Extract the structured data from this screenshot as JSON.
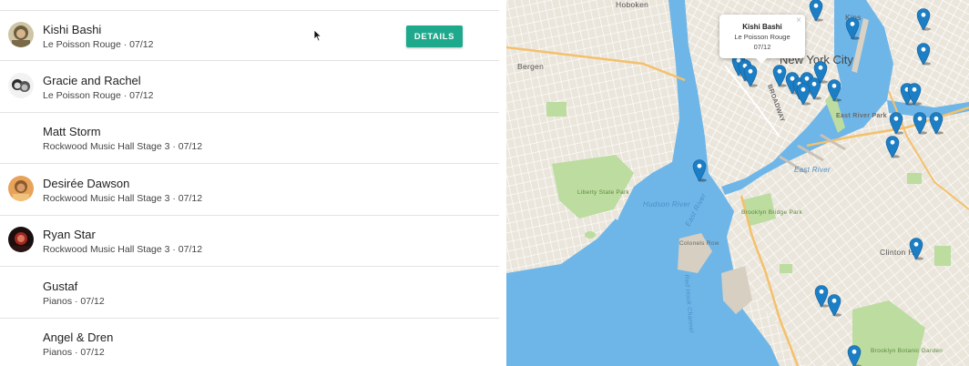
{
  "events": [
    {
      "title": "Kishi Bashi",
      "venue": "Le Poisson Rouge · 07/12",
      "has_avatar": true,
      "avatar": "avatar-kishi",
      "show_details": true
    },
    {
      "title": "Gracie and Rachel",
      "venue": "Le Poisson Rouge · 07/12",
      "has_avatar": true,
      "avatar": "avatar-gracie",
      "show_details": false
    },
    {
      "title": "Matt Storm",
      "venue": "Rockwood Music Hall Stage 3 · 07/12",
      "has_avatar": false,
      "show_details": false
    },
    {
      "title": "Desirée Dawson",
      "venue": "Rockwood Music Hall Stage 3 · 07/12",
      "has_avatar": true,
      "avatar": "avatar-desiree",
      "show_details": false
    },
    {
      "title": "Ryan Star",
      "venue": "Rockwood Music Hall Stage 3 · 07/12",
      "has_avatar": true,
      "avatar": "avatar-ryan",
      "show_details": false
    },
    {
      "title": "Gustaf",
      "venue": "Pianos · 07/12",
      "has_avatar": false,
      "show_details": false
    },
    {
      "title": "Angel & Dren",
      "venue": "Pianos · 07/12",
      "has_avatar": false,
      "show_details": false
    }
  ],
  "details_label": "DETAILS",
  "popup": {
    "title": "Kishi Bashi",
    "venue": "Le Poisson Rouge",
    "date": "07/12",
    "close": "×"
  },
  "map_labels": {
    "new_york_city": "New York City",
    "hoboken": "Hoboken",
    "bergen": "Bergen",
    "liberty_state_park": "Liberty State Park",
    "brooklyn_bridge_park": "Brooklyn Bridge Park",
    "east_river": "East River",
    "east_river_park": "East River Park",
    "governors_island": "Colonels Row",
    "clinton_hill": "Clinton Hill",
    "brooklyn_botanic_garden": "Brooklyn Botanic Garden",
    "hudson_river": "Hudson River",
    "east_river_2": "East River",
    "red_hook": "Red Hook Channel",
    "kips_bay": "Kips",
    "east_village": "East Village",
    "broadway": "BROADWAY"
  },
  "colors": {
    "accent": "#1fa98c",
    "water": "#6fb6e8",
    "land": "#ebe6dc",
    "park": "#bcdca0",
    "pin": "#1c7ec4"
  }
}
